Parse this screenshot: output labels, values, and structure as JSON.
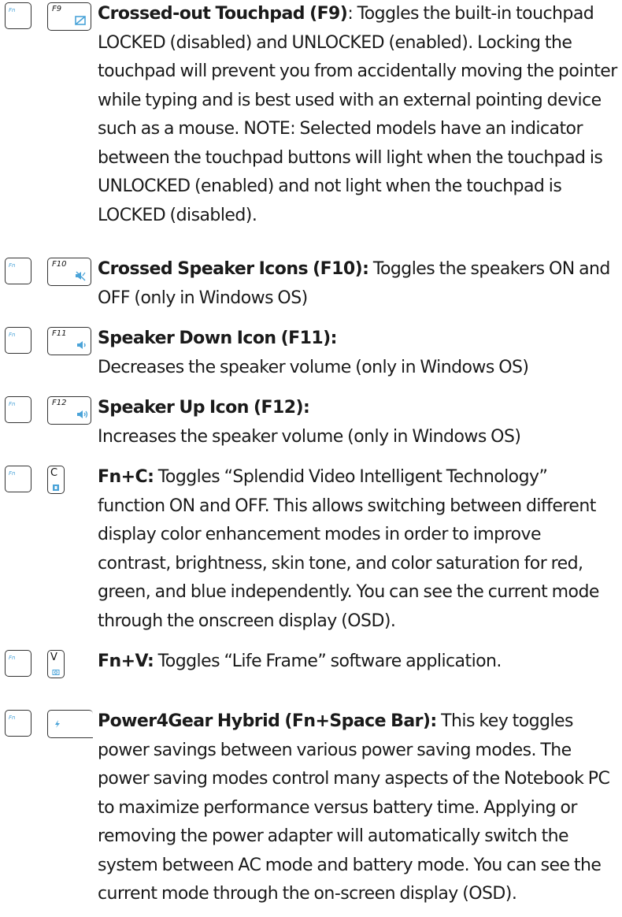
{
  "entries": [
    {
      "fn_label": "Fn",
      "key_label": "F9",
      "icon": "touchpad-crossed-icon",
      "title": "Crossed-out Touchpad (F9)",
      "description": ": Toggles the built-in touchpad LOCKED (disabled) and UNLOCKED (enabled). Locking the touchpad will prevent you from accidentally moving the pointer while typing and is best used with an external pointing device such as a mouse. NOTE: Selected models have an indicator between the touchpad buttons will light when the touchpad is UNLOCKED (enabled) and not light when the touchpad is LOCKED (disabled)."
    },
    {
      "fn_label": "Fn",
      "key_label": "F10",
      "icon": "speaker-crossed-icon",
      "title": "Crossed Speaker Icons (F10):",
      "description": " Toggles the speakers ON and OFF (only in Windows OS)"
    },
    {
      "fn_label": "Fn",
      "key_label": "F11",
      "icon": "speaker-down-icon",
      "title": "Speaker Down Icon (F11):",
      "description": "Decreases the speaker volume (only in Windows OS)"
    },
    {
      "fn_label": "Fn",
      "key_label": "F12",
      "icon": "speaker-up-icon",
      "title": "Speaker Up Icon (F12):",
      "description": "Increases the speaker volume (only in Windows OS)"
    },
    {
      "fn_label": "Fn",
      "key_label": "C",
      "icon": "splendid-icon",
      "title": "Fn+C:",
      "description": " Toggles “Splendid Video Intelligent Technology” function ON and OFF. This allows switching between different display color enhancement modes in order to improve contrast, brightness, skin tone, and color saturation for red, green, and blue independently. You can see the current mode through the onscreen display (OSD)."
    },
    {
      "fn_label": "Fn",
      "key_label": "V",
      "icon": "camera-icon",
      "title": "Fn+V:",
      "description": " Toggles “Life Frame” software application."
    },
    {
      "fn_label": "Fn",
      "key_label": "",
      "icon": "power4gear-icon",
      "title": "Power4Gear Hybrid (Fn+Space Bar):",
      "description": " This key toggles power savings between various power saving modes. The power saving modes control many aspects of the Notebook PC to maximize performance versus battery time. Applying or removing the power adapter will automatically switch the system between AC mode and battery mode. You can see the current mode through the on-screen display (OSD)."
    }
  ],
  "colors": {
    "icon_blue": "#4aa3d8",
    "text": "#1a1a1a"
  }
}
